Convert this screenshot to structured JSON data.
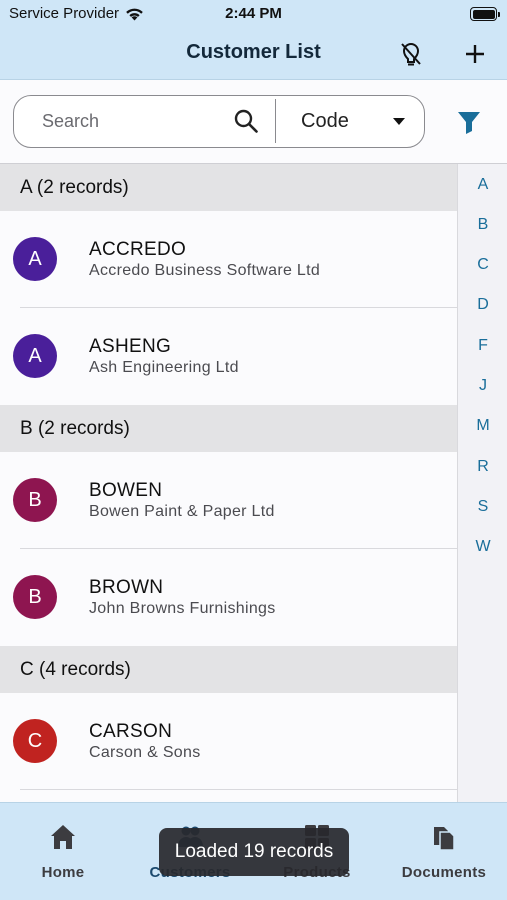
{
  "status_bar": {
    "carrier": "Service Provider",
    "time": "2:44 PM"
  },
  "nav": {
    "title": "Customer List",
    "left_action_icon": "location-off-icon",
    "add_icon": "plus-icon"
  },
  "search": {
    "placeholder": "Search",
    "value": "",
    "sort_field": "Code"
  },
  "sections": [
    {
      "header": "A (2 records)",
      "rows": [
        {
          "initial": "A",
          "code": "ACCREDO",
          "name": "Accredo Business Software Ltd",
          "color": "#4a1f9a"
        },
        {
          "initial": "A",
          "code": "ASHENG",
          "name": "Ash Engineering Ltd",
          "color": "#4a1f9a"
        }
      ]
    },
    {
      "header": "B (2 records)",
      "rows": [
        {
          "initial": "B",
          "code": "BOWEN",
          "name": "Bowen Paint & Paper Ltd",
          "color": "#8e1550"
        },
        {
          "initial": "B",
          "code": "BROWN",
          "name": "John Browns Furnishings",
          "color": "#8e1550"
        }
      ]
    },
    {
      "header": "C (4 records)",
      "rows": [
        {
          "initial": "C",
          "code": "CARSON",
          "name": "Carson & Sons",
          "color": "#c02320"
        }
      ]
    }
  ],
  "index_letters": [
    "A",
    "B",
    "C",
    "D",
    "F",
    "J",
    "M",
    "R",
    "S",
    "W"
  ],
  "tabs": [
    {
      "label": "Home",
      "icon": "home-icon"
    },
    {
      "label": "Customers",
      "icon": "customers-icon"
    },
    {
      "label": "Products",
      "icon": "products-icon"
    },
    {
      "label": "Documents",
      "icon": "documents-icon"
    }
  ],
  "toast": "Loaded 19 records",
  "colors": {
    "bar_background": "#cfe6f7",
    "accent": "#1a6e9a"
  }
}
